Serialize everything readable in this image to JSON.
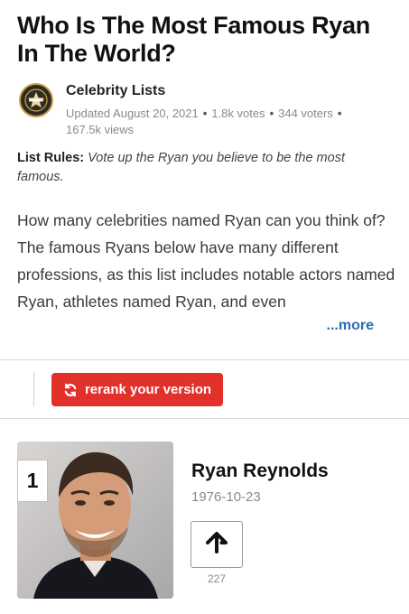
{
  "article": {
    "title": "Who Is The Most Famous Ryan In The World?",
    "author": "Celebrity Lists",
    "updated": "Updated August 20, 2021",
    "votes": "1.8k votes",
    "voters": "344 voters",
    "views": "167.5k views",
    "rules_label": "List Rules:",
    "rules_text": "Vote up the Ryan you believe to be the most famous.",
    "description": "How many celebrities named Ryan can you think of? The famous Ryans below have many different professions, as this list includes notable actors named Ryan, athletes named Ryan, and even",
    "more_label": "...more"
  },
  "toolbar": {
    "rerank_label": "rerank your version",
    "rerank_icon": "refresh-icon"
  },
  "list": {
    "items": [
      {
        "rank": "1",
        "name": "Ryan Reynolds",
        "date": "1976-10-23",
        "upvotes": "227",
        "upvote_icon": "arrow-up-icon"
      }
    ]
  },
  "colors": {
    "accent_red": "#e2302b",
    "link_blue": "#2b6fb3",
    "meta_gray": "#8a8a8a"
  }
}
